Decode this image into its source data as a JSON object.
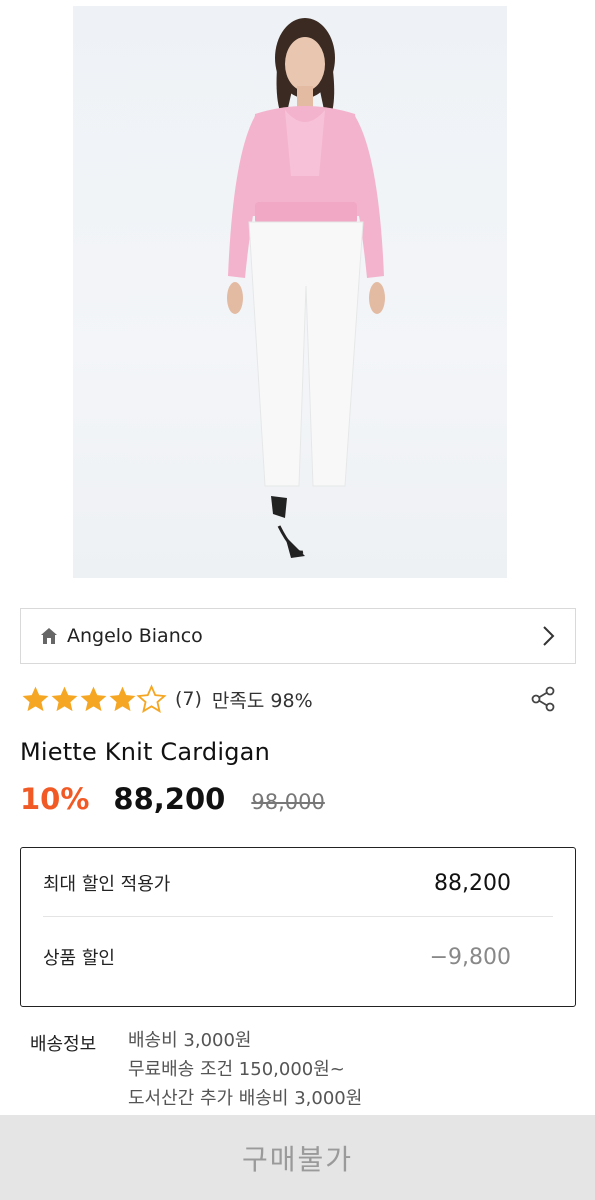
{
  "brand": {
    "name": "Angelo Bianco"
  },
  "rating": {
    "stars": 4.5,
    "review_count": "(7)",
    "satisfaction": "만족도 98%"
  },
  "product": {
    "name": "Miette Knit Cardigan",
    "discount": "10%",
    "price": "88,200",
    "original_price": "98,000"
  },
  "price_box": {
    "max_discount_label": "최대 할인 적용가",
    "max_discount_value": "88,200",
    "product_discount_label": "상품 할인",
    "product_discount_value": "−9,800"
  },
  "shipping": {
    "label": "배송정보",
    "lines": [
      "배송비 3,000원",
      "무료배송 조건 150,000원~",
      "도서산간 추가 배송비 3,000원"
    ]
  },
  "buy_bar": {
    "label": "구매불가"
  },
  "colors": {
    "accent": "#f15a24",
    "star": "#f5a623",
    "disabled_bar": "#e5e5e5"
  },
  "icons": {
    "home": "home-icon",
    "chevron": "chevron-right-icon",
    "share": "share-icon",
    "star": "star-icon"
  }
}
